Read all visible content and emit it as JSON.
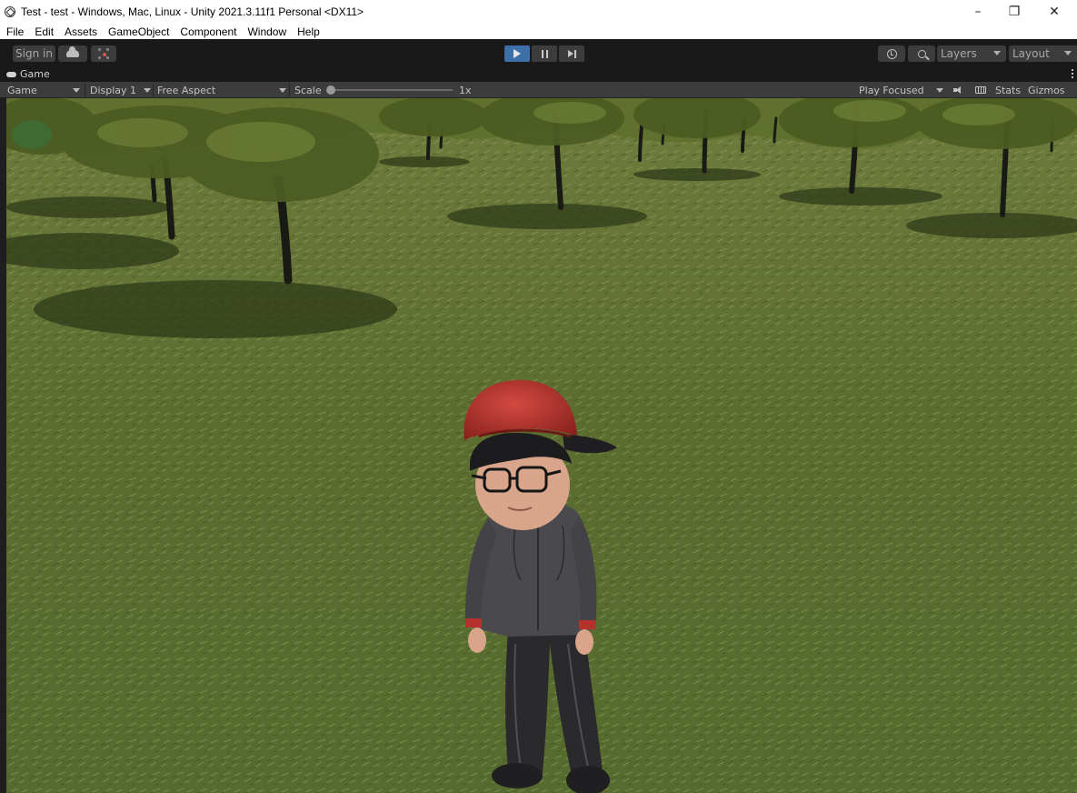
{
  "window": {
    "title": "Test - test - Windows, Mac, Linux - Unity 2021.3.11f1 Personal <DX11>",
    "minimize_glyph": "–",
    "restore_glyph": "❐",
    "close_glyph": "✕"
  },
  "menu": [
    "File",
    "Edit",
    "Assets",
    "GameObject",
    "Component",
    "Window",
    "Help"
  ],
  "toolbar": {
    "sign_in": "Sign in",
    "layers": "Layers",
    "layout": "Layout",
    "icons": {
      "cloud": "cloud-icon",
      "collab": "collab-icon",
      "play": "play-icon",
      "pause": "pause-icon",
      "step": "step-icon",
      "history": "history-icon",
      "search": "search-icon"
    },
    "play_active_color": "#3d6fa8"
  },
  "game_tab": {
    "label": "Game",
    "icon": "gamepad-icon"
  },
  "game_view_bar": {
    "view_mode": "Game",
    "display": "Display 1",
    "aspect": "Free Aspect",
    "scale_label": "Scale",
    "scale_value": "1x",
    "play_mode": "Play Focused",
    "stats": "Stats",
    "gizmos": "Gizmos",
    "icons": {
      "mute_audio": "speaker-icon",
      "shortcuts": "keyboard-icon"
    }
  },
  "scene": {
    "ground_color": "#5b6b2e",
    "sky_tint": "#6f7f3a",
    "character_cap_color": "#b5322c",
    "character_hoodie_color": "#4a4a4e"
  }
}
